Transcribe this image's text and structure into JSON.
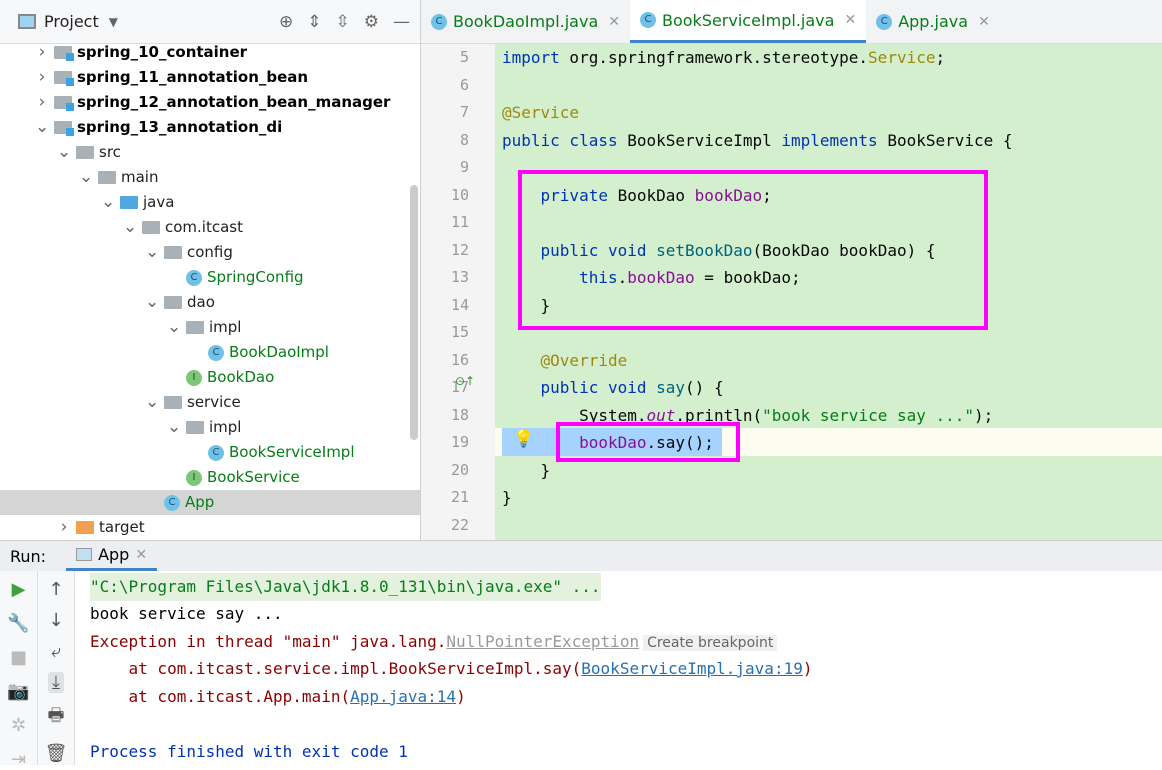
{
  "project": {
    "title": "Project",
    "tree": [
      {
        "label": "spring_10_container",
        "level": 0,
        "chev": ">",
        "icon": "module",
        "style": "bold"
      },
      {
        "label": "spring_11_annotation_bean",
        "level": 0,
        "chev": ">",
        "icon": "module",
        "style": "bold"
      },
      {
        "label": "spring_12_annotation_bean_manager",
        "level": 0,
        "chev": ">",
        "icon": "module",
        "style": "bold"
      },
      {
        "label": "spring_13_annotation_di",
        "level": 0,
        "chev": "v",
        "icon": "module",
        "style": "bold"
      },
      {
        "label": "src",
        "level": 1,
        "chev": "v",
        "icon": "folder"
      },
      {
        "label": "main",
        "level": 2,
        "chev": "v",
        "icon": "folder"
      },
      {
        "label": "java",
        "level": 3,
        "chev": "v",
        "icon": "src"
      },
      {
        "label": "com.itcast",
        "level": 4,
        "chev": "v",
        "icon": "folder"
      },
      {
        "label": "config",
        "level": 5,
        "chev": "v",
        "icon": "folder"
      },
      {
        "label": "SpringConfig",
        "level": 6,
        "chev": "",
        "icon": "class",
        "style": "green"
      },
      {
        "label": "dao",
        "level": 5,
        "chev": "v",
        "icon": "folder"
      },
      {
        "label": "impl",
        "level": 6,
        "chev": "v",
        "icon": "folder"
      },
      {
        "label": "BookDaoImpl",
        "level": 7,
        "chev": "",
        "icon": "class",
        "style": "green"
      },
      {
        "label": "BookDao",
        "level": 6,
        "chev": "",
        "icon": "interface",
        "style": "green"
      },
      {
        "label": "service",
        "level": 5,
        "chev": "v",
        "icon": "folder"
      },
      {
        "label": "impl",
        "level": 6,
        "chev": "v",
        "icon": "folder"
      },
      {
        "label": "BookServiceImpl",
        "level": 7,
        "chev": "",
        "icon": "class",
        "style": "green"
      },
      {
        "label": "BookService",
        "level": 6,
        "chev": "",
        "icon": "interface",
        "style": "green"
      },
      {
        "label": "App",
        "level": 5,
        "chev": "",
        "icon": "class",
        "style": "green",
        "selected": true
      },
      {
        "label": "target",
        "level": 1,
        "chev": ">",
        "icon": "target"
      }
    ]
  },
  "tabs": [
    {
      "label": "BookDaoImpl.java"
    },
    {
      "label": "BookServiceImpl.java",
      "active": true
    },
    {
      "label": "App.java"
    }
  ],
  "editor": {
    "lines": [
      {
        "n": "5",
        "html": "<span class='kw'>import</span> org.springframework.stereotype.<span class='an'>Service</span>;"
      },
      {
        "n": "6",
        "html": ""
      },
      {
        "n": "7",
        "html": "<span class='an'>@Service</span>"
      },
      {
        "n": "8",
        "html": "<span class='kw'>public class</span> BookServiceImpl <span class='kw'>implements</span> BookService {"
      },
      {
        "n": "9",
        "html": ""
      },
      {
        "n": "10",
        "html": "    <span class='kw'>private</span> BookDao <span class='fd'>bookDao</span>;"
      },
      {
        "n": "11",
        "html": ""
      },
      {
        "n": "12",
        "html": "    <span class='kw'>public void</span> <span class='fn'>setBookDao</span>(BookDao bookDao) {"
      },
      {
        "n": "13",
        "html": "        <span class='kw'>this</span>.<span class='fd'>bookDao</span> = bookDao;"
      },
      {
        "n": "14",
        "html": "    }"
      },
      {
        "n": "15",
        "html": ""
      },
      {
        "n": "16",
        "html": "    <span class='an'>@Override</span>"
      },
      {
        "n": "17",
        "html": "    <span class='kw'>public void</span> <span class='fn'>say</span>() {"
      },
      {
        "n": "18",
        "html": "        System.<span class='it'>out</span>.println(<span class='st'>\"book service say ...\"</span>);"
      },
      {
        "n": "19",
        "html": "        <span class='fd'>bookDao</span>.say();"
      },
      {
        "n": "20",
        "html": "    }"
      },
      {
        "n": "21",
        "html": "}"
      },
      {
        "n": "22",
        "html": ""
      }
    ]
  },
  "run": {
    "label": "Run:",
    "tab": "App",
    "console": {
      "cmd": "\"C:\\Program Files\\Java\\jdk1.8.0_131\\bin\\java.exe\" ...",
      "out": "book service say ...",
      "exc_prefix": "Exception in thread \"main\" java.lang.",
      "exc_class": "NullPointerException",
      "create_bp": "Create breakpoint",
      "at1_prefix": "    at com.itcast.service.impl.BookServiceImpl.say(",
      "at1_link": "BookServiceImpl.java:19",
      "at2_prefix": "    at com.itcast.App.main(",
      "at2_link": "App.java:14",
      "close": ")",
      "exit": "Process finished with exit code 1"
    }
  },
  "colors": {
    "highlight": "#ff00ff",
    "editor_bg": "#d3efcd"
  }
}
